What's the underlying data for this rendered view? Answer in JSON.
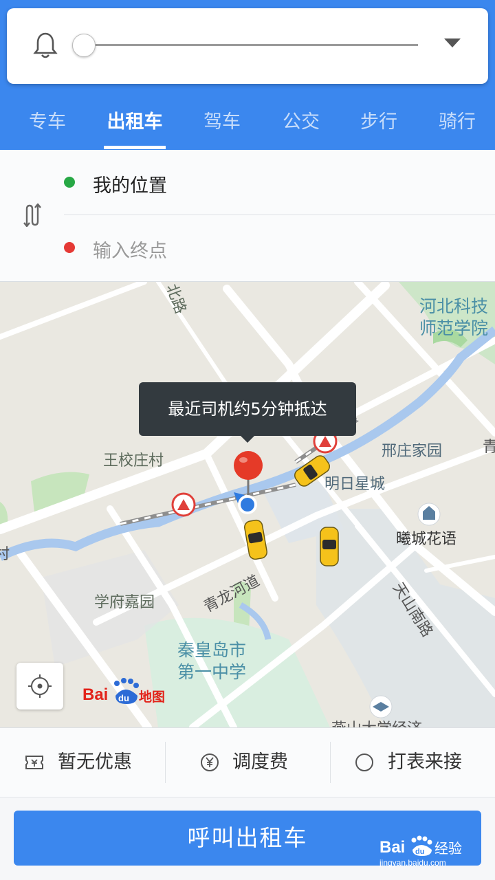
{
  "tabs": [
    {
      "label": "专车",
      "active": false
    },
    {
      "label": "出租车",
      "active": true
    },
    {
      "label": "驾车",
      "active": false
    },
    {
      "label": "公交",
      "active": false
    },
    {
      "label": "步行",
      "active": false
    },
    {
      "label": "骑行",
      "active": false
    }
  ],
  "volume": {
    "level": 0.0
  },
  "route": {
    "start": "我的位置",
    "end_placeholder": "输入终点"
  },
  "map": {
    "tooltip": "最近司机约5分钟抵达",
    "labels": {
      "north_road": "北路",
      "campus_line1": "河北科技",
      "campus_line2": "师范学院",
      "wangxiao": "王校庄村",
      "xingzhuang": "邢庄家园",
      "mingri": "明日星城",
      "xicheng": "曦城花语",
      "xuefu": "学府嘉园",
      "qinglong": "青龙河道",
      "tianshan": "天山南路",
      "school_line1": "秦皇岛市",
      "school_line2": "第一中学",
      "yanshan": "燕山大学经济",
      "edge_qing": "青",
      "edge_cun": "村"
    },
    "logo": {
      "part1": "Bai",
      "part2": "du",
      "part3": "地图"
    }
  },
  "options": {
    "coupon": "暂无优惠",
    "dispatch": "调度费",
    "meter": "打表来接"
  },
  "call_button": "呼叫出租车",
  "watermark": {
    "brand": "Bai",
    "brand2": "du",
    "product": "经验",
    "url": "jingyan.baidu.com"
  },
  "colors": {
    "brand_blue": "#3b87ee",
    "start_green": "#27a845",
    "end_red": "#e53935",
    "taxi_yellow": "#f5c21b"
  }
}
